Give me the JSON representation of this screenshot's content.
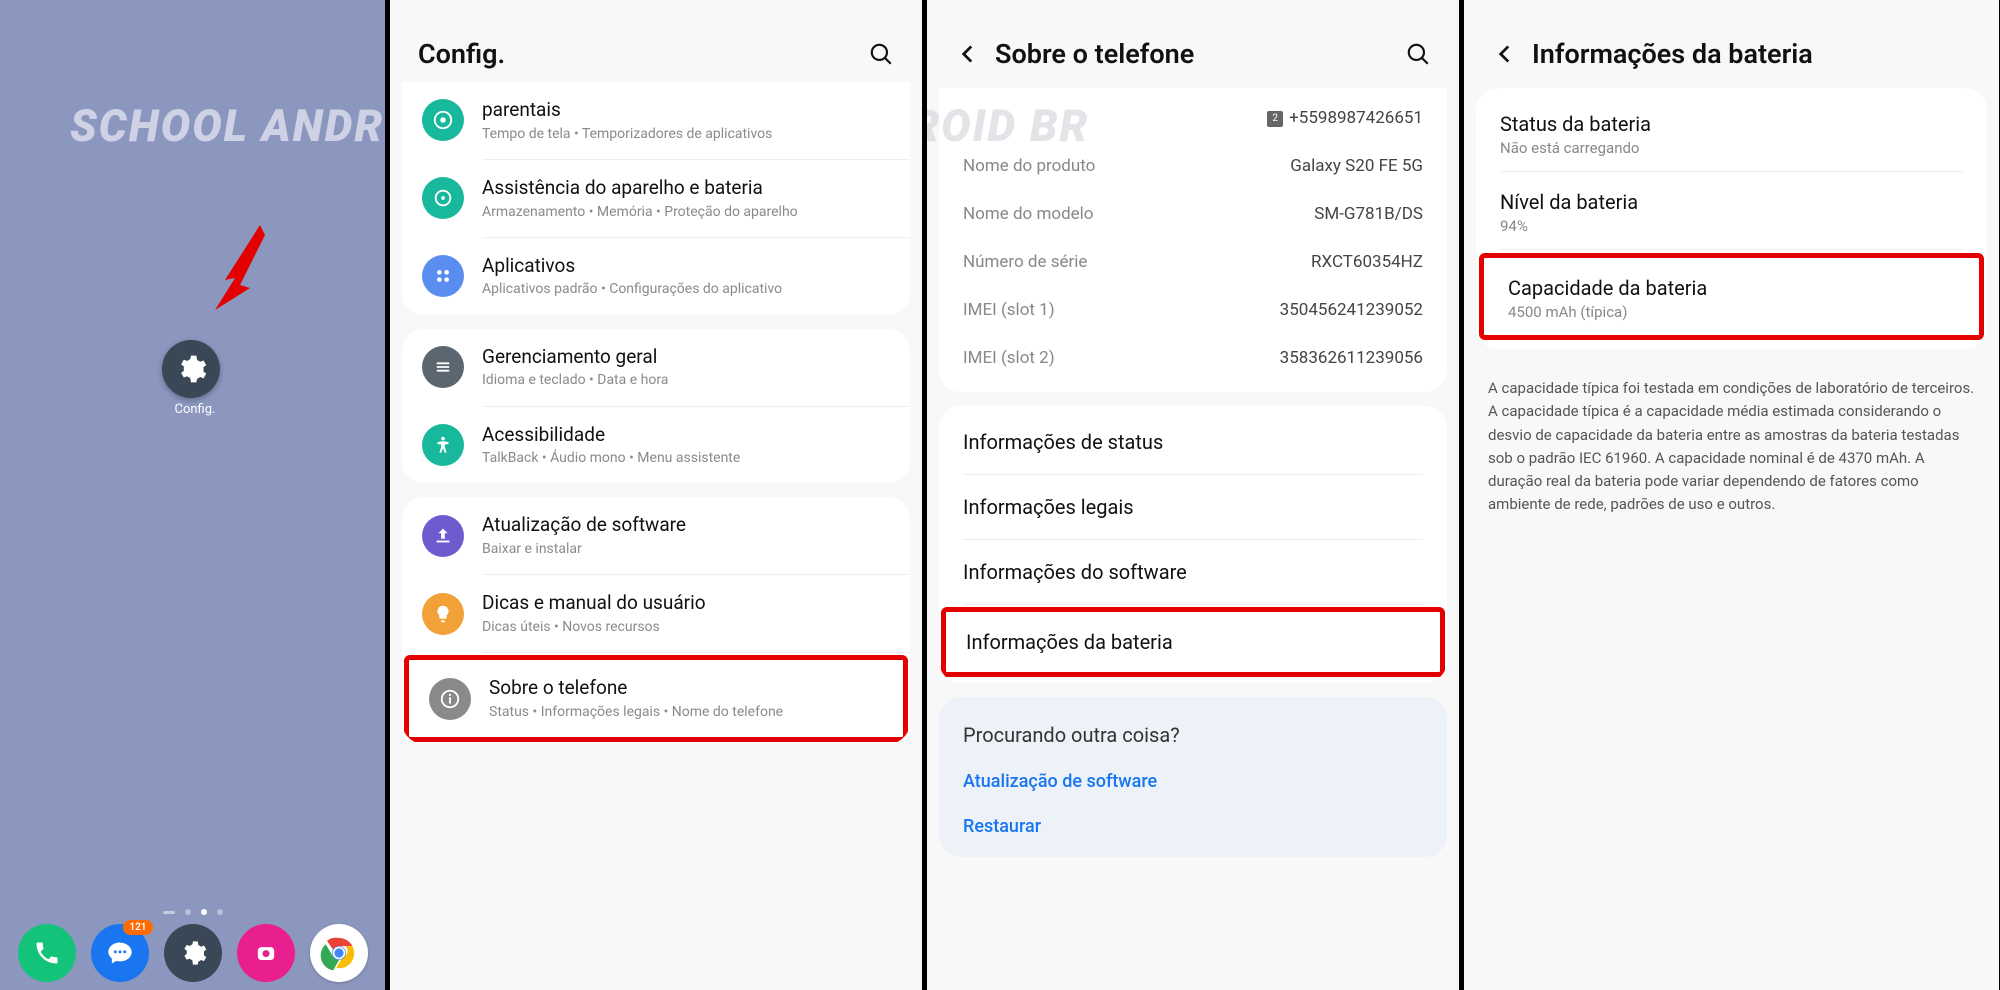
{
  "watermark": "SCHOOL ANDROID BR",
  "panel1": {
    "config_label": "Config.",
    "badge": "121"
  },
  "panel2": {
    "title": "Config.",
    "items": [
      {
        "title": "parentais",
        "sub": "Tempo de tela  •  Temporizadores de aplicativos"
      },
      {
        "title": "Assistência do aparelho e bateria",
        "sub": "Armazenamento  •  Memória  •  Proteção do aparelho"
      },
      {
        "title": "Aplicativos",
        "sub": "Aplicativos padrão  •  Configurações do aplicativo"
      },
      {
        "title": "Gerenciamento geral",
        "sub": "Idioma e teclado  •  Data e hora"
      },
      {
        "title": "Acessibilidade",
        "sub": "TalkBack  •  Áudio mono  •  Menu assistente"
      },
      {
        "title": "Atualização de software",
        "sub": "Baixar e instalar"
      },
      {
        "title": "Dicas e manual do usuário",
        "sub": "Dicas úteis  •  Novos recursos"
      },
      {
        "title": "Sobre o telefone",
        "sub": "Status  •  Informações legais  •  Nome do telefone"
      }
    ]
  },
  "panel3": {
    "title": "Sobre o telefone",
    "phone": "+5598987426651",
    "info": [
      {
        "label": "Nome do produto",
        "value": "Galaxy S20 FE 5G"
      },
      {
        "label": "Nome do modelo",
        "value": "SM-G781B/DS"
      },
      {
        "label": "Número de série",
        "value": "RXCT60354HZ"
      },
      {
        "label": "IMEI (slot 1)",
        "value": "350456241239052"
      },
      {
        "label": "IMEI (slot 2)",
        "value": "358362611239056"
      }
    ],
    "rows": [
      "Informações de status",
      "Informações legais",
      "Informações do software",
      "Informações da bateria"
    ],
    "looking": "Procurando outra coisa?",
    "links": [
      "Atualização de software",
      "Restaurar"
    ]
  },
  "panel4": {
    "title": "Informações da bateria",
    "items": [
      {
        "title": "Status da bateria",
        "sub": "Não está carregando"
      },
      {
        "title": "Nível da bateria",
        "sub": "94%"
      },
      {
        "title": "Capacidade da bateria",
        "sub": "4500 mAh (típica)"
      }
    ],
    "desc": "A capacidade típica foi testada em condições de laboratório de terceiros. A capacidade típica é a capacidade média estimada considerando o desvio de capacidade da bateria entre as amostras da bateria testadas sob o padrão IEC 61960. A capacidade nominal é de 4370 mAh. A duração real da bateria pode variar dependendo de fatores como ambiente de rede, padrões de uso e outros."
  }
}
